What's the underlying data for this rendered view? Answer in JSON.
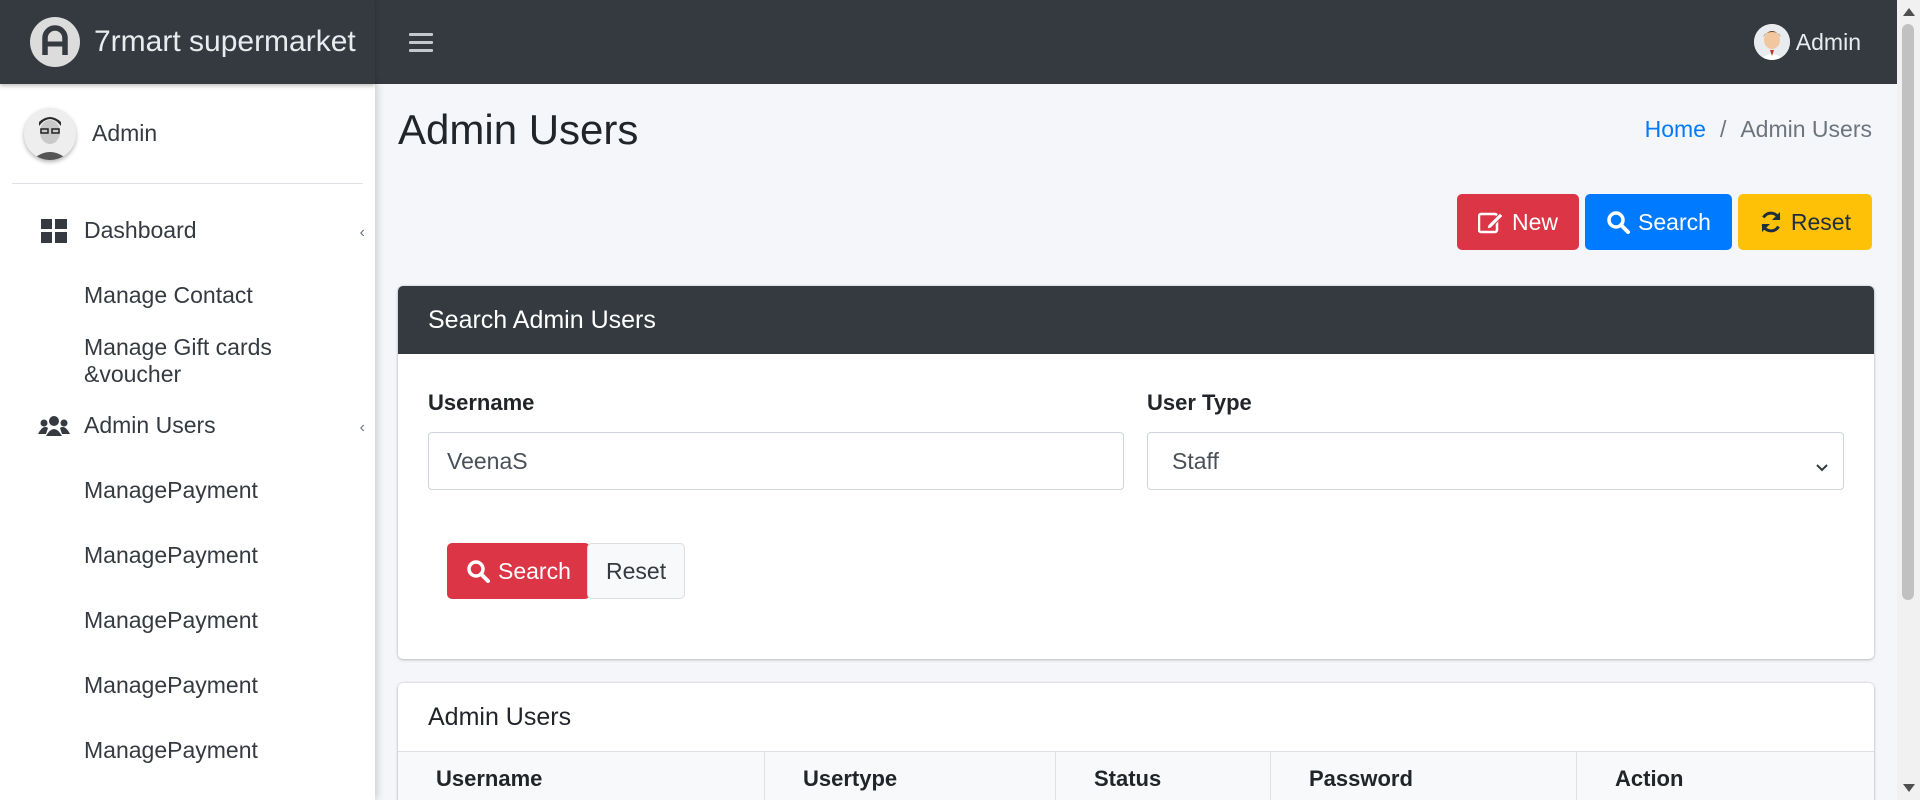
{
  "brand": {
    "name": "7rmart supermarket"
  },
  "navbar": {
    "user_name": "Admin"
  },
  "sidebar": {
    "user_name": "Admin",
    "items": [
      {
        "label": "Dashboard",
        "icon": "dashboard-icon",
        "has_caret": true
      },
      {
        "label": "Manage Contact"
      },
      {
        "label": "Manage Gift cards &voucher"
      },
      {
        "label": "Admin Users",
        "icon": "users-icon",
        "has_caret": true
      },
      {
        "label": "ManagePayment"
      },
      {
        "label": "ManagePayment"
      },
      {
        "label": "ManagePayment"
      },
      {
        "label": "ManagePayment"
      },
      {
        "label": "ManagePayment"
      }
    ]
  },
  "page": {
    "title": "Admin Users",
    "breadcrumb": {
      "home": "Home",
      "separator": "/",
      "current": "Admin Users"
    }
  },
  "toolbar": {
    "new_label": "New",
    "search_label": "Search",
    "reset_label": "Reset"
  },
  "search_card": {
    "title": "Search Admin Users",
    "username_label": "Username",
    "username_value": "VeenaS",
    "usertype_label": "User Type",
    "usertype_value": "Staff",
    "search_button": "Search",
    "reset_button": "Reset"
  },
  "table": {
    "title": "Admin Users",
    "columns": [
      "Username",
      "Usertype",
      "Status",
      "Password",
      "Action"
    ]
  },
  "colors": {
    "dark": "#343a40",
    "danger": "#dc3545",
    "primary": "#007bff",
    "warning": "#ffc107",
    "link": "#007bff"
  }
}
